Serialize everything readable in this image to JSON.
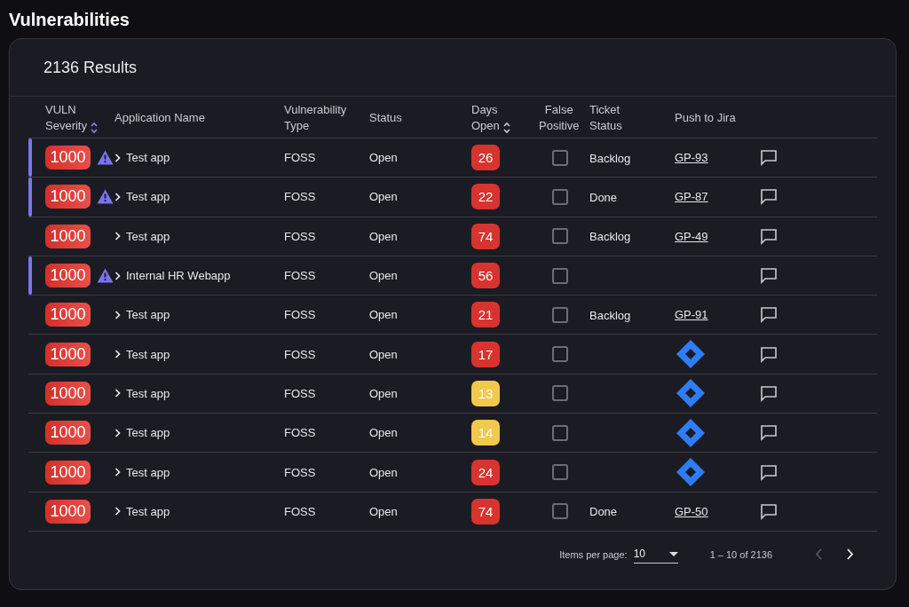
{
  "page_title": "Vulnerabilities",
  "results": "2136 Results",
  "columns": [
    {
      "lines": [
        "VULN",
        "Severity"
      ],
      "sortable": true,
      "sorted": true
    },
    {
      "lines": [
        "Application Name"
      ],
      "sortable": false
    },
    {
      "lines": [
        "Vulnerability",
        "Type"
      ],
      "sortable": false
    },
    {
      "lines": [
        "Status"
      ],
      "sortable": false
    },
    {
      "lines": [
        "Days",
        "Open"
      ],
      "sortable": true,
      "sorted": false
    },
    {
      "lines": [
        "False",
        "Positive"
      ],
      "sortable": false
    },
    {
      "lines": [
        "Ticket",
        "Status"
      ],
      "sortable": false
    },
    {
      "lines": [
        "Push to Jira"
      ],
      "sortable": false
    }
  ],
  "rows": [
    {
      "flagged": true,
      "severity": "1000",
      "app": "Test app",
      "type": "FOSS",
      "status": "Open",
      "days": {
        "text": "26",
        "color": "#d8332f"
      },
      "false_positive": false,
      "ticket": "Backlog",
      "jira": {
        "kind": "link",
        "text": "GP-93"
      }
    },
    {
      "flagged": true,
      "severity": "1000",
      "app": "Test app",
      "type": "FOSS",
      "status": "Open",
      "days": {
        "text": "22",
        "color": "#d8332f"
      },
      "false_positive": false,
      "ticket": "Done",
      "jira": {
        "kind": "link",
        "text": "GP-87"
      }
    },
    {
      "flagged": false,
      "severity": "1000",
      "app": "Test app",
      "type": "FOSS",
      "status": "Open",
      "days": {
        "text": "74",
        "color": "#d8332f"
      },
      "false_positive": false,
      "ticket": "Backlog",
      "jira": {
        "kind": "link",
        "text": "GP-49"
      }
    },
    {
      "flagged": true,
      "severity": "1000",
      "app": "Internal HR Webapp",
      "type": "FOSS",
      "status": "Open",
      "days": {
        "text": "56",
        "color": "#d8332f"
      },
      "false_positive": false,
      "jira": {
        "kind": "none"
      }
    },
    {
      "flagged": false,
      "severity": "1000",
      "app": "Test app",
      "type": "FOSS",
      "status": "Open",
      "days": {
        "text": "21",
        "color": "#d8332f"
      },
      "false_positive": false,
      "ticket": "Backlog",
      "jira": {
        "kind": "link",
        "text": "GP-91"
      }
    },
    {
      "flagged": false,
      "severity": "1000",
      "app": "Test app",
      "type": "FOSS",
      "status": "Open",
      "days": {
        "text": "17",
        "color": "#d8332f"
      },
      "false_positive": false,
      "jira": {
        "kind": "button"
      }
    },
    {
      "flagged": false,
      "severity": "1000",
      "app": "Test app",
      "type": "FOSS",
      "status": "Open",
      "days": {
        "text": "13",
        "color": "#f2c94c"
      },
      "false_positive": false,
      "jira": {
        "kind": "button"
      }
    },
    {
      "flagged": false,
      "severity": "1000",
      "app": "Test app",
      "type": "FOSS",
      "status": "Open",
      "days": {
        "text": "14",
        "color": "#f2c94c"
      },
      "false_positive": false,
      "jira": {
        "kind": "button"
      }
    },
    {
      "flagged": false,
      "severity": "1000",
      "app": "Test app",
      "type": "FOSS",
      "status": "Open",
      "days": {
        "text": "24",
        "color": "#d8332f"
      },
      "false_positive": false,
      "jira": {
        "kind": "button"
      }
    },
    {
      "flagged": false,
      "severity": "1000",
      "app": "Test app",
      "type": "FOSS",
      "status": "Open",
      "days": {
        "text": "74",
        "color": "#d8332f"
      },
      "false_positive": false,
      "ticket": "Done",
      "jira": {
        "kind": "link",
        "text": "GP-50"
      }
    }
  ],
  "pagination": {
    "label": "Items per page:",
    "page_size": "10",
    "range": "1 – 10 of 2136",
    "prev_disabled": true,
    "next_disabled": false
  }
}
